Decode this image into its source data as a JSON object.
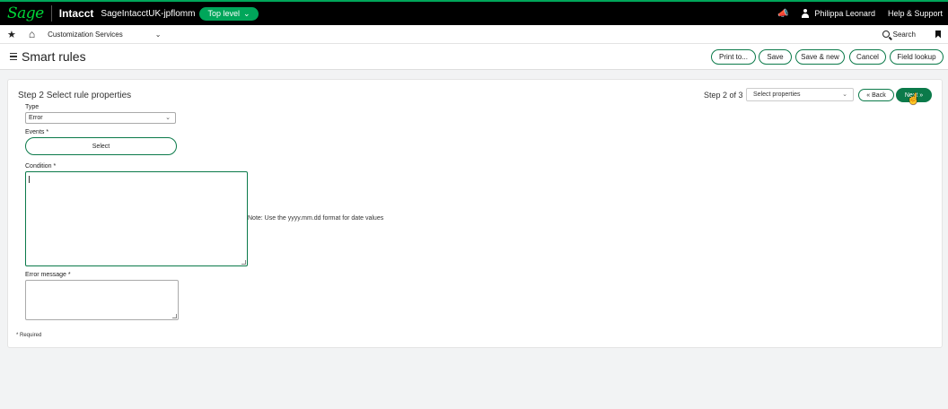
{
  "topbar": {
    "logo": "Sage",
    "product": "Intacct",
    "company": "SageIntacctUK-jpflomm",
    "level_label": "Top level",
    "level_chevron": "⌄",
    "megaphone_icon": "📣",
    "user_name": "Philippa Leonard",
    "help_label": "Help & Support"
  },
  "navbar": {
    "star_icon": "★",
    "home_icon": "⌂",
    "menu_label": "Customization Services",
    "menu_chevron": "⌄",
    "search_label": "Search"
  },
  "titlebar": {
    "title": "Smart rules",
    "buttons": [
      "Print to...",
      "Save",
      "Save & new",
      "Cancel",
      "Field lookup"
    ]
  },
  "wizard": {
    "heading": "Step 2 Select rule properties",
    "step_label": "Step 2 of 3",
    "step_select_value": "Select properties",
    "select_chevron": "⌄",
    "back_label": "« Back",
    "next_label": "Next »"
  },
  "form": {
    "type_label": "Type",
    "type_value": "Error",
    "events_label": "Events",
    "events_button": "Select",
    "condition_label": "Condition",
    "note": "Note: Use the yyyy.mm.dd format for date values",
    "error_label": "Error message",
    "required_marker": "*",
    "required_note": "* Required"
  },
  "colors": {
    "brand_green": "#0b7a4a",
    "accent_green": "#00a65a",
    "logo_green": "#00d639",
    "topbar_bg": "#000000"
  }
}
